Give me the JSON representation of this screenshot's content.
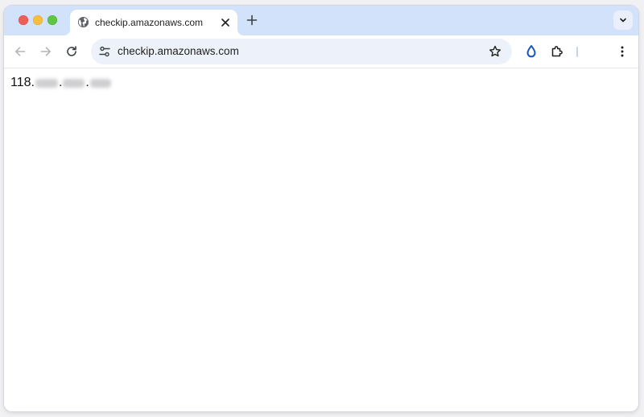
{
  "window": {
    "traffic_lights": [
      "close",
      "minimize",
      "zoom"
    ]
  },
  "tab": {
    "title": "checkip.amazonaws.com",
    "favicon": "globe-icon",
    "close_icon": "close-icon"
  },
  "new_tab_icon": "plus-icon",
  "tab_search_icon": "chevron-down-icon",
  "toolbar": {
    "back_icon": "arrow-left-icon",
    "forward_icon": "arrow-right-icon",
    "reload_icon": "reload-icon",
    "site_info_icon": "tune-icon",
    "url": "checkip.amazonaws.com",
    "bookmark_icon": "star-icon",
    "extension_drop_icon": "droplet-icon",
    "extensions_icon": "puzzle-icon",
    "menu_icon": "kebab-menu-icon"
  },
  "page": {
    "ip_prefix": "118",
    "separator": ".",
    "redacted_segments": 3
  },
  "colors": {
    "titlebar": "#d3e2fb",
    "omnibox": "#edf2fa",
    "droplet": "#1a55c7"
  }
}
